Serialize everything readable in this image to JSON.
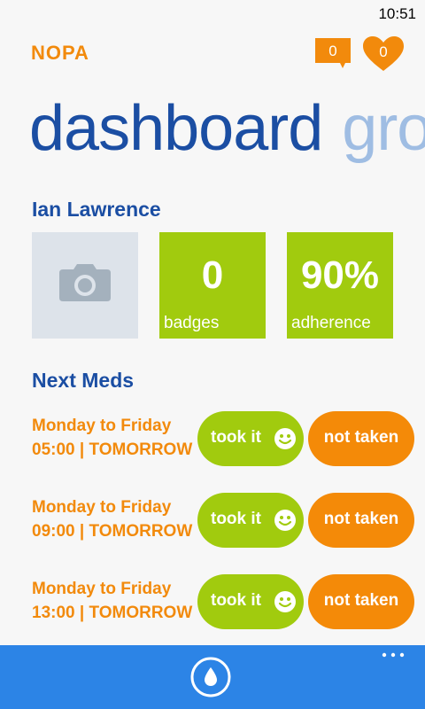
{
  "status_bar": {
    "time": "10:51"
  },
  "header": {
    "app_title": "NOPA",
    "messages_count": "0",
    "likes_count": "0"
  },
  "pivot": {
    "active": "dashboard",
    "next": "gro"
  },
  "profile": {
    "name": "Ian Lawrence",
    "tiles": [
      {
        "value": "0",
        "label": "badges"
      },
      {
        "value": "90%",
        "label": "adherence"
      }
    ]
  },
  "next_meds": {
    "title": "Next Meds",
    "took_label": "took it",
    "not_taken_label": "not taken",
    "items": [
      {
        "days": "Monday to Friday",
        "time": "05:00 | TOMORROW"
      },
      {
        "days": "Monday to Friday",
        "time": "09:00 | TOMORROW"
      },
      {
        "days": "Monday to Friday",
        "time": "13:00 | TOMORROW"
      }
    ]
  },
  "colors": {
    "brand_orange": "#f28a0c",
    "brand_blue": "#1b4ea3",
    "tile_green": "#a1cb0e",
    "app_bar_blue": "#2c84e6"
  },
  "icons": {
    "app_bar_button": "water-drop-icon",
    "more": "more-dots-icon",
    "messages": "speech-bubble-icon",
    "likes": "heart-icon",
    "photo": "camera-icon",
    "took": "smiley-icon"
  }
}
